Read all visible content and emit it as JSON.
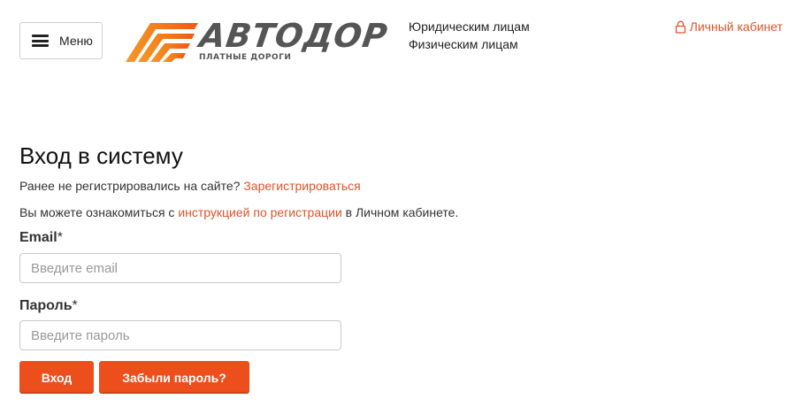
{
  "header": {
    "menu_label": "Меню",
    "logo_text": "АВТОДОР",
    "logo_subtitle": "ПЛАТНЫЕ ДОРОГИ",
    "links": [
      "Юридическим лицам",
      "Физическим лицам"
    ],
    "cabinet_label": "Личный кабинет"
  },
  "login": {
    "title": "Вход в систему",
    "register_prompt": "Ранее не регистрировались на сайте?",
    "register_link": "Зарегистрироваться",
    "instruction_prefix": "Вы можете ознакомиться с",
    "instruction_link": "инструкцией по регистрации",
    "instruction_suffix": "в Личном кабинете.",
    "email_label": "Email",
    "email_placeholder": "Введите email",
    "email_value": "",
    "password_label": "Пароль",
    "password_placeholder": "Введите пароль",
    "password_value": "",
    "required_mark": "*",
    "login_button": "Вход",
    "forgot_button": "Забыли пароль?"
  },
  "colors": {
    "accent": "#e0532a",
    "button": "#ec4e1c",
    "logo_orange": "#f07a1a",
    "logo_gray": "#555555"
  },
  "icons": {
    "menu": "hamburger-icon",
    "logo": "road-logo-icon",
    "cabinet": "lock-icon"
  }
}
